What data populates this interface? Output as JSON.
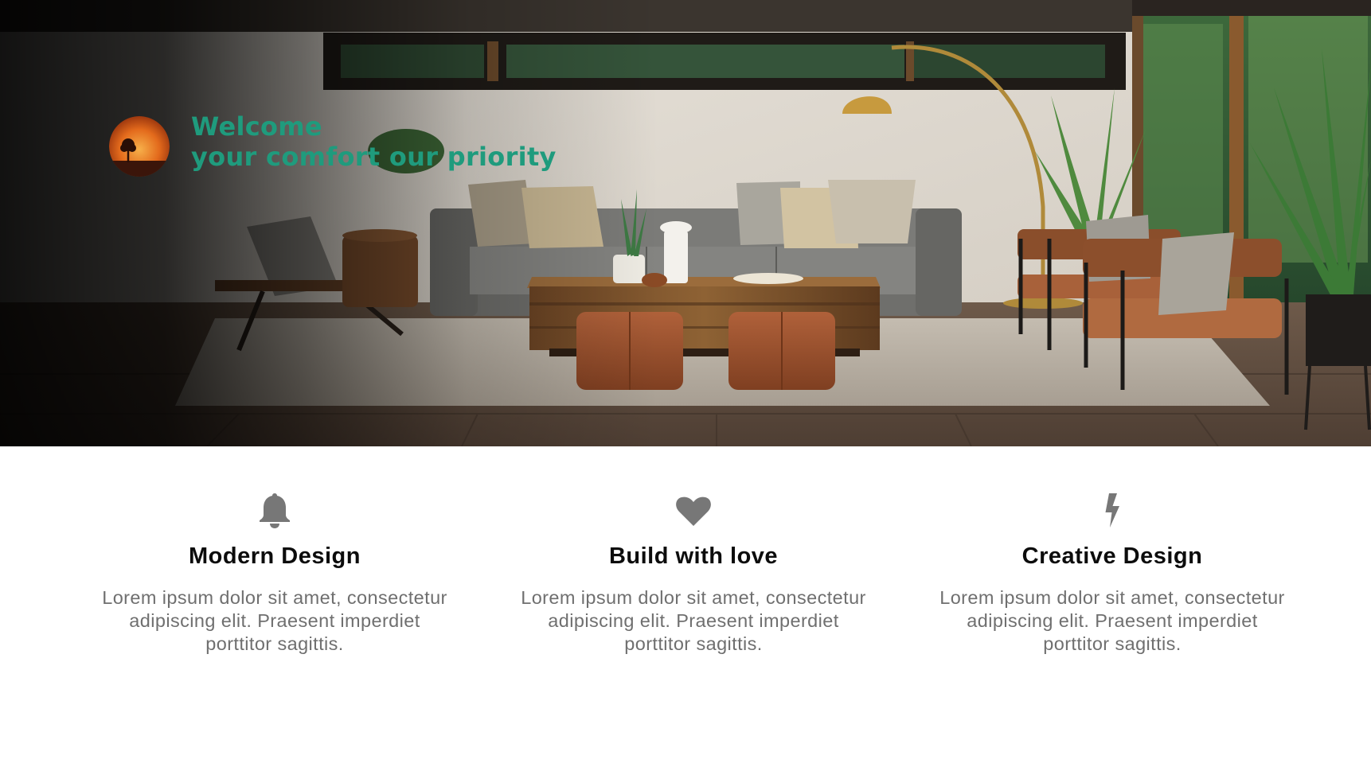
{
  "hero": {
    "welcome_line1": "Welcome",
    "welcome_line2": "your comfort our priority",
    "accent_color": "#1f9b7d",
    "logo_icon": "sunset-tree-logo-icon"
  },
  "features": [
    {
      "icon": "bell-icon",
      "title": "Modern Design",
      "text": "Lorem ipsum dolor sit amet, consectetur adipiscing elit. Praesent imperdiet porttitor sagittis."
    },
    {
      "icon": "heart-icon",
      "title": "Build with love",
      "text": "Lorem ipsum dolor sit amet, consectetur adipiscing elit. Praesent imperdiet porttitor sagittis."
    },
    {
      "icon": "lightning-icon",
      "title": "Creative Design",
      "text": "Lorem ipsum dolor sit amet, consectetur adipiscing elit. Praesent imperdiet porttitor sagittis."
    }
  ],
  "colors": {
    "icon_gray": "#777777",
    "title_black": "#0c0c0c",
    "body_gray": "#6f6f6f"
  }
}
